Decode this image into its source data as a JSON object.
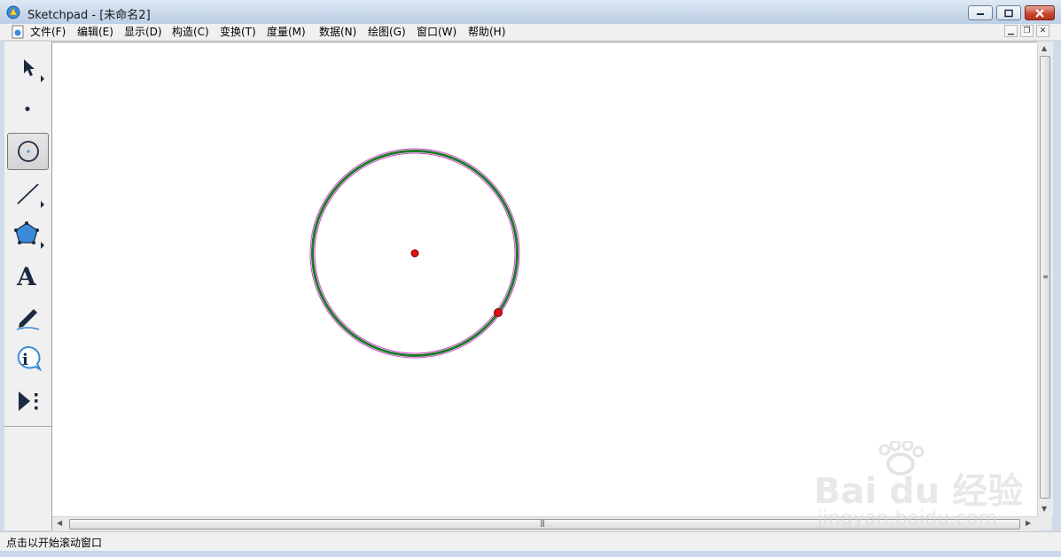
{
  "window": {
    "app_name": "Sketchpad",
    "title": "Sketchpad  - [未命名2]"
  },
  "menu": {
    "items": [
      {
        "label": "文件(F)"
      },
      {
        "label": "编辑(E)"
      },
      {
        "label": "显示(D)"
      },
      {
        "label": "构造(C)"
      },
      {
        "label": "变换(T)"
      },
      {
        "label": "度量(M)"
      },
      {
        "label": "数据(N)"
      },
      {
        "label": "绘图(G)"
      },
      {
        "label": "窗口(W)"
      },
      {
        "label": "帮助(H)"
      }
    ]
  },
  "toolbox": {
    "tools": [
      {
        "name": "selection-arrow-tool",
        "icon": "arrow-icon"
      },
      {
        "name": "point-tool",
        "icon": "point-icon"
      },
      {
        "name": "compass-tool",
        "icon": "circle-icon",
        "selected": true
      },
      {
        "name": "straightedge-tool",
        "icon": "segment-icon"
      },
      {
        "name": "polygon-tool",
        "icon": "pentagon-icon"
      },
      {
        "name": "text-tool",
        "icon": "text-A-icon",
        "glyph": "A"
      },
      {
        "name": "marker-tool",
        "icon": "pen-icon"
      },
      {
        "name": "information-tool",
        "icon": "info-icon",
        "glyph": "i"
      },
      {
        "name": "custom-tool",
        "icon": "play-dots-icon"
      }
    ]
  },
  "canvas": {
    "circle": {
      "stroke": "#1f7a2a",
      "highlight": "#cc44cc"
    },
    "center_point": {
      "color": "#e01010"
    },
    "edge_point": {
      "color": "#e01010"
    }
  },
  "status": {
    "text": "点击以开始滚动窗口"
  },
  "watermark": {
    "line1": "Bai du 经验",
    "line2": "jingyan.baidu.com"
  },
  "colors": {
    "titlebar": "#c9d8ea",
    "close_button": "#c7442c",
    "canvas_bg": "#ffffff"
  }
}
